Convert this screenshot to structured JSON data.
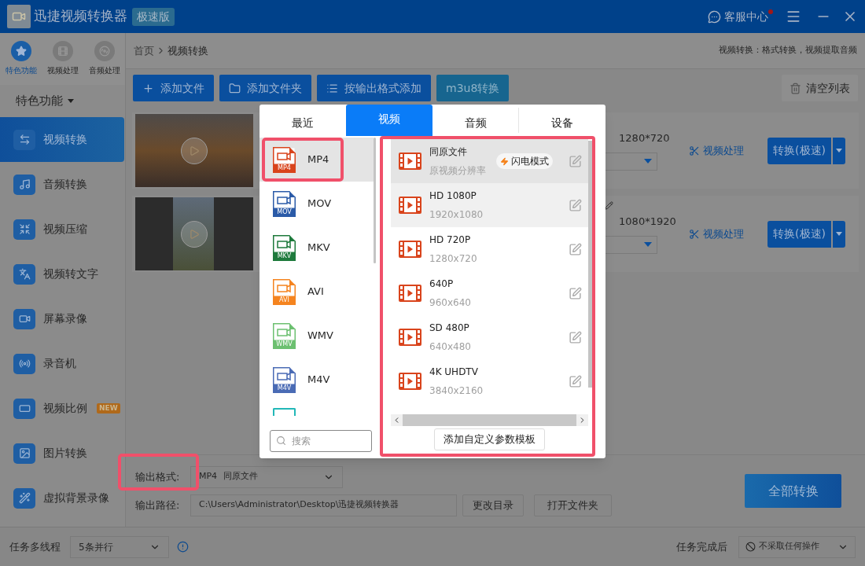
{
  "title_bar": {
    "app_name": "迅捷视频转换器",
    "edition": "极速版",
    "support": "客服中心",
    "notification": true
  },
  "mode_tabs": [
    {
      "label": "特色功能",
      "selected": true
    },
    {
      "label": "视频处理",
      "selected": false
    },
    {
      "label": "音频处理",
      "selected": false
    }
  ],
  "section": {
    "label": "特色功能",
    "expanded": true
  },
  "nav": [
    {
      "label": "视频转换",
      "selected": true
    },
    {
      "label": "音频转换",
      "selected": false
    },
    {
      "label": "视频压缩",
      "selected": false
    },
    {
      "label": "视频转文字",
      "selected": false
    },
    {
      "label": "屏幕录像",
      "selected": false
    },
    {
      "label": "录音机",
      "selected": false
    },
    {
      "label": "视频比例",
      "selected": false,
      "badge": "NEW"
    },
    {
      "label": "图片转换",
      "selected": false
    },
    {
      "label": "虚拟背景录像",
      "selected": false
    }
  ],
  "breadcrumb": [
    "首页",
    "视频转换"
  ],
  "page_hint": "视频转换：格式转换，视频提取音频",
  "toolbar": [
    {
      "label": "添加文件",
      "kind": "add"
    },
    {
      "label": "添加文件夹",
      "kind": "folder"
    },
    {
      "label": "按输出格式添加",
      "kind": "list"
    },
    {
      "label": "m3u8转换",
      "kind": "accent"
    }
  ],
  "clear_button": "清空列表",
  "files": [
    {
      "resolution": "1280*720",
      "edit_mark": false,
      "process": "视频处理",
      "convert": "转换(极速)",
      "kind": "landscape"
    },
    {
      "resolution": "1080*1920",
      "edit_mark": true,
      "process": "视频处理",
      "convert": "转换(极速)",
      "kind": "portrait"
    }
  ],
  "format_popup": {
    "tabs": [
      {
        "label": "最近",
        "selected": false
      },
      {
        "label": "视频",
        "selected": true
      },
      {
        "label": "音频",
        "selected": false
      },
      {
        "label": "设备",
        "selected": false
      }
    ],
    "formats": [
      {
        "name": "MP4",
        "badge": "MP4",
        "color": "#d9441c",
        "selected": true,
        "highlight": true
      },
      {
        "name": "MOV",
        "badge": "MOV",
        "color": "#2b5ba8",
        "selected": false,
        "highlight": false
      },
      {
        "name": "MKV",
        "badge": "MKV",
        "color": "#1e7a3c",
        "selected": false,
        "highlight": false
      },
      {
        "name": "AVI",
        "badge": "AVI",
        "color": "#f5841f",
        "selected": false,
        "highlight": false
      },
      {
        "name": "WMV",
        "badge": "WMV",
        "color": "#6cc070",
        "selected": false,
        "highlight": false
      },
      {
        "name": "M4V",
        "badge": "M4V",
        "color": "#4a6bb5",
        "selected": false,
        "highlight": false
      }
    ],
    "search": {
      "placeholder": "搜索"
    },
    "presets_highlight": true,
    "presets": [
      {
        "name": "同原文件",
        "detail": "原视频分辨率",
        "badge": "闪电模式",
        "selected": true,
        "hovered": false
      },
      {
        "name": "HD 1080P",
        "detail": "1920x1080",
        "selected": false,
        "hovered": true
      },
      {
        "name": "HD 720P",
        "detail": "1280x720",
        "selected": false,
        "hovered": false
      },
      {
        "name": "640P",
        "detail": "960x640",
        "selected": false,
        "hovered": false
      },
      {
        "name": "SD 480P",
        "detail": "640x480",
        "selected": false,
        "hovered": false
      },
      {
        "name": "4K UHDTV",
        "detail": "3840x2160",
        "selected": false,
        "hovered": false
      }
    ],
    "custom_button": "添加自定义参数模板"
  },
  "output": {
    "format_label": "输出格式:",
    "format_label_highlight": true,
    "format_value": "MP4",
    "format_preset": "同原文件",
    "path_label": "输出路径:",
    "path_value": "C:\\Users\\Administrator\\Desktop\\迅捷视频转换器",
    "change_dir": "更改目录",
    "open_folder": "打开文件夹",
    "convert_all": "全部转换"
  },
  "status_bar": {
    "threads_label": "任务多线程",
    "threads_value": "5条并行",
    "after_label": "任务完成后",
    "after_value": "不采取任何操作"
  }
}
